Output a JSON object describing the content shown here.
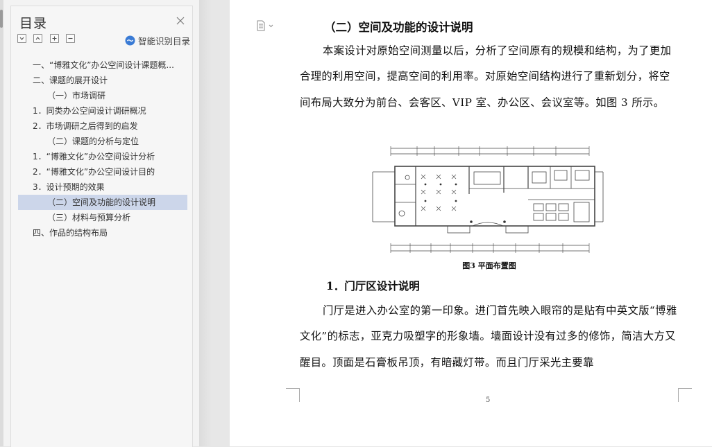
{
  "sidebar": {
    "title": "目录",
    "smart_toc_label": "智能识别目录",
    "items": [
      {
        "label": "一、“博雅文化”办公空间设计课题概...",
        "level": 1,
        "selected": false
      },
      {
        "label": "二、课题的展开设计",
        "level": 1,
        "selected": false
      },
      {
        "label": "（一）市场调研",
        "level": 2,
        "selected": false
      },
      {
        "label": "1．同类办公空间设计调研概况",
        "level": 3,
        "selected": false
      },
      {
        "label": "2．市场调研之后得到的启发",
        "level": 3,
        "selected": false
      },
      {
        "label": "（二）课题的分析与定位",
        "level": 2,
        "selected": false
      },
      {
        "label": "1．“博雅文化”办公空间设计分析",
        "level": 3,
        "selected": false
      },
      {
        "label": "2．“博雅文化”办公空间设计目的",
        "level": 3,
        "selected": false
      },
      {
        "label": "3．设计预期的效果",
        "level": 3,
        "selected": false
      },
      {
        "label": "（二）空间及功能的设计说明",
        "level": 2,
        "selected": true
      },
      {
        "label": "（三）材料与预算分析",
        "level": 2,
        "selected": false
      },
      {
        "label": "四、作品的结构布局",
        "level": 1,
        "selected": false
      }
    ]
  },
  "document": {
    "heading": "（二）空间及功能的设计说明",
    "para1": "本案设计对原始空间测量以后，分析了空间原有的规模和结构，为了更加合理的利用空间，提高空间的利用率。对原始空间结构进行了重新划分，将空间布局大致分为前台、会客区、VIP 室、办公区、会议室等。如图 3 所示。",
    "figure_caption": "图3  平面布置图",
    "heading2": "1．门厅区设计说明",
    "para2": "门厅是进入办公室的第一印象。进门首先映入眼帘的是贴有中英文版“博雅文化”的标志，亚克力吸塑字的形象墙。墙面设计没有过多的修饰，简洁大方又醒目。顶面是石膏板吊顶，有暗藏灯带。而且门厅采光主要靠",
    "page_number": "5"
  },
  "colors": {
    "selected_bg": "#ccd6ea",
    "sidebar_bg": "#f3f3f3",
    "page_bg": "#ffffff",
    "smart_icon": "#3a7bd5"
  },
  "icons": [
    "close-icon",
    "collapse-all-icon",
    "expand-all-icon",
    "add-heading-icon",
    "remove-heading-icon",
    "smart-toc-icon",
    "document-menu-icon"
  ]
}
